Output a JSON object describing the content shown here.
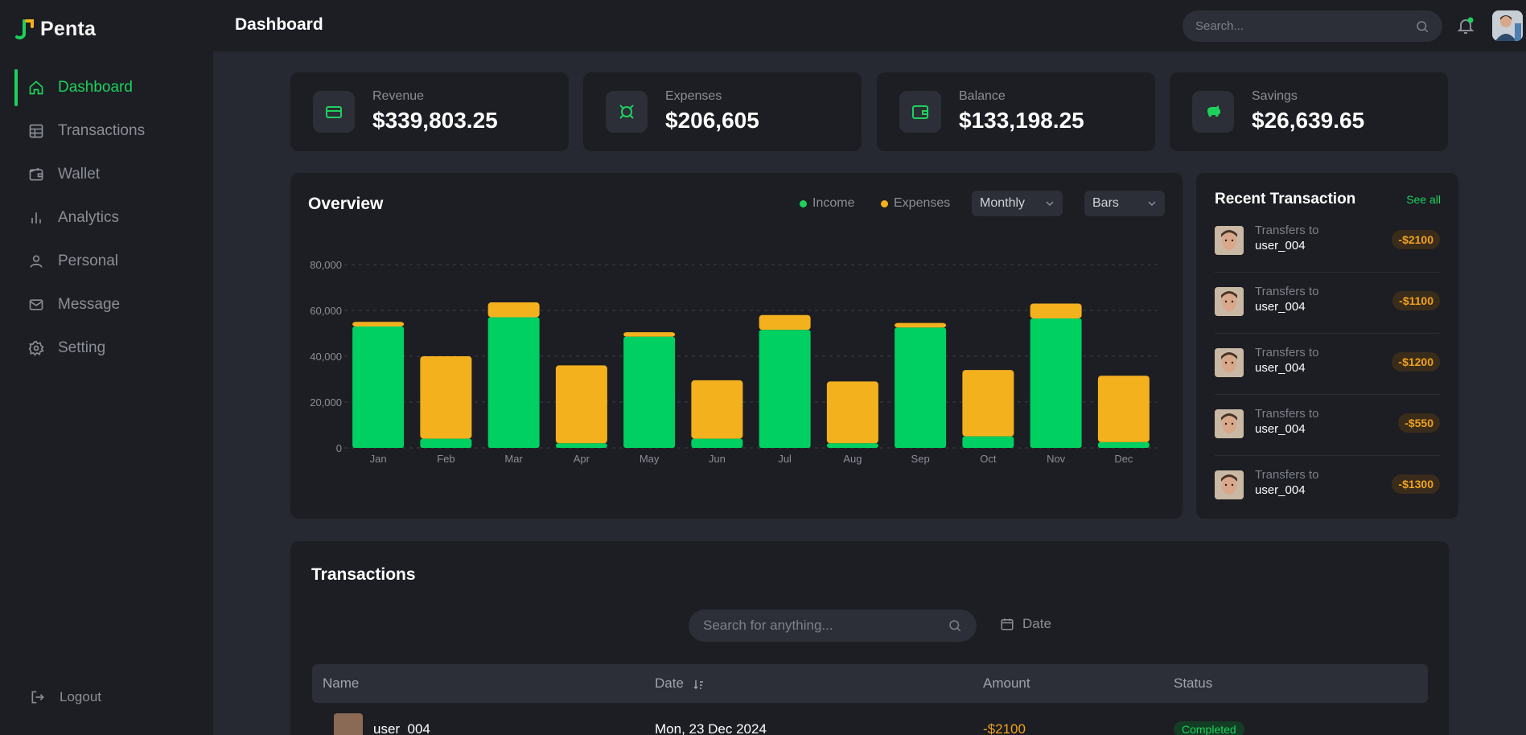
{
  "app": {
    "name": "Penta"
  },
  "colors": {
    "accent": "#1dd15d",
    "income": "#00d062",
    "expenses": "#f4b11e"
  },
  "sidebar": {
    "items": [
      {
        "label": "Dashboard",
        "icon": "home-icon",
        "active": true
      },
      {
        "label": "Transactions",
        "icon": "table-icon",
        "active": false
      },
      {
        "label": "Wallet",
        "icon": "wallet-icon",
        "active": false
      },
      {
        "label": "Analytics",
        "icon": "bar-chart-icon",
        "active": false
      },
      {
        "label": "Personal",
        "icon": "user-icon",
        "active": false
      },
      {
        "label": "Message",
        "icon": "mail-icon",
        "active": false
      },
      {
        "label": "Setting",
        "icon": "gear-icon",
        "active": false
      }
    ],
    "logout_label": "Logout"
  },
  "header": {
    "title": "Dashboard",
    "search_placeholder": "Search..."
  },
  "stats": [
    {
      "label": "Revenue",
      "value": "$339,803.25",
      "icon": "card-icon"
    },
    {
      "label": "Expenses",
      "value": "$206,605",
      "icon": "expenses-icon"
    },
    {
      "label": "Balance",
      "value": "$133,198.25",
      "icon": "wallet-icon"
    },
    {
      "label": "Savings",
      "value": "$26,639.65",
      "icon": "piggy-bank-icon"
    }
  ],
  "overview": {
    "title": "Overview",
    "legend_income": "Income",
    "legend_expenses": "Expenses",
    "period_select": "Monthly",
    "type_select": "Bars"
  },
  "chart_data": {
    "type": "bar",
    "stacked": true,
    "categories": [
      "Jan",
      "Feb",
      "Mar",
      "Apr",
      "May",
      "Jun",
      "Jul",
      "Aug",
      "Sep",
      "Oct",
      "Nov",
      "Dec"
    ],
    "series": [
      {
        "name": "Income",
        "values": [
          53000,
          4000,
          57000,
          2000,
          48500,
          4000,
          51500,
          2000,
          52500,
          5000,
          56500,
          2500
        ]
      },
      {
        "name": "Expenses",
        "values": [
          2000,
          36000,
          6500,
          34000,
          2000,
          25500,
          6500,
          27000,
          2000,
          29000,
          6500,
          29000
        ]
      }
    ],
    "ylim": [
      0,
      80000
    ],
    "yticks": [
      "0",
      "20,000",
      "40,000",
      "60,000",
      "80,000"
    ],
    "grid": true
  },
  "recent": {
    "title": "Recent Transaction",
    "see_all": "See all",
    "items": [
      {
        "sub": "Transfers to",
        "user": "user_004",
        "amount": "-$2100"
      },
      {
        "sub": "Transfers to",
        "user": "user_004",
        "amount": "-$1100"
      },
      {
        "sub": "Transfers to",
        "user": "user_004",
        "amount": "-$1200"
      },
      {
        "sub": "Transfers to",
        "user": "user_004",
        "amount": "-$550"
      },
      {
        "sub": "Transfers to",
        "user": "user_004",
        "amount": "-$1300"
      }
    ]
  },
  "transactions": {
    "title": "Transactions",
    "search_placeholder": "Search for anything...",
    "date_label": "Date",
    "columns": [
      "Name",
      "Date",
      "Amount",
      "Status"
    ],
    "rows": [
      {
        "name": "user_004",
        "date": "Mon, 23 Dec 2024",
        "amount": "-$2100",
        "status": "Completed"
      }
    ]
  }
}
